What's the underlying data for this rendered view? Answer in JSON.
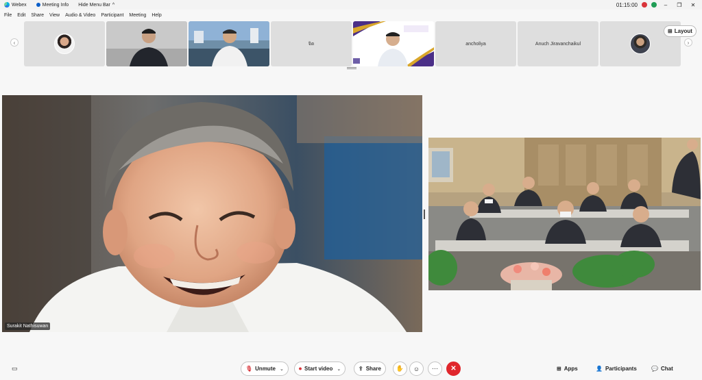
{
  "titlebar": {
    "app_name": "Webex",
    "meeting_info": "Meeting Info",
    "hide_menu": "Hide Menu Bar",
    "time": "01:15:00"
  },
  "menu": [
    "File",
    "Edit",
    "Share",
    "View",
    "Audio & Video",
    "Participant",
    "Meeting",
    "Help"
  ],
  "thumbnails": [
    {
      "type": "avatar",
      "name": ""
    },
    {
      "type": "video",
      "name": ""
    },
    {
      "type": "video",
      "name": ""
    },
    {
      "type": "name",
      "name": "จิต"
    },
    {
      "type": "video",
      "name": ""
    },
    {
      "type": "name",
      "name": "ancholiya"
    },
    {
      "type": "name",
      "name": "Anuch Jiravanchaikul"
    },
    {
      "type": "avatar",
      "name": ""
    }
  ],
  "layout_label": "Layout",
  "main_video": {
    "participant": "Surakit Nathisuwan"
  },
  "controls": {
    "unmute": "Unmute",
    "start_video": "Start video",
    "share": "Share",
    "apps": "Apps",
    "participants": "Participants",
    "chat": "Chat"
  },
  "icons": [
    "webex-logo-icon",
    "info-icon",
    "mic-muted-icon",
    "video-off-icon",
    "share-icon",
    "raise-hand-icon",
    "reactions-icon",
    "more-icon",
    "end-call-icon",
    "apps-icon",
    "participants-icon",
    "chat-icon",
    "captions-icon"
  ],
  "colors": {
    "end_call": "#e0262c",
    "mute_red": "#d9343a",
    "background": "#f7f7f7"
  }
}
